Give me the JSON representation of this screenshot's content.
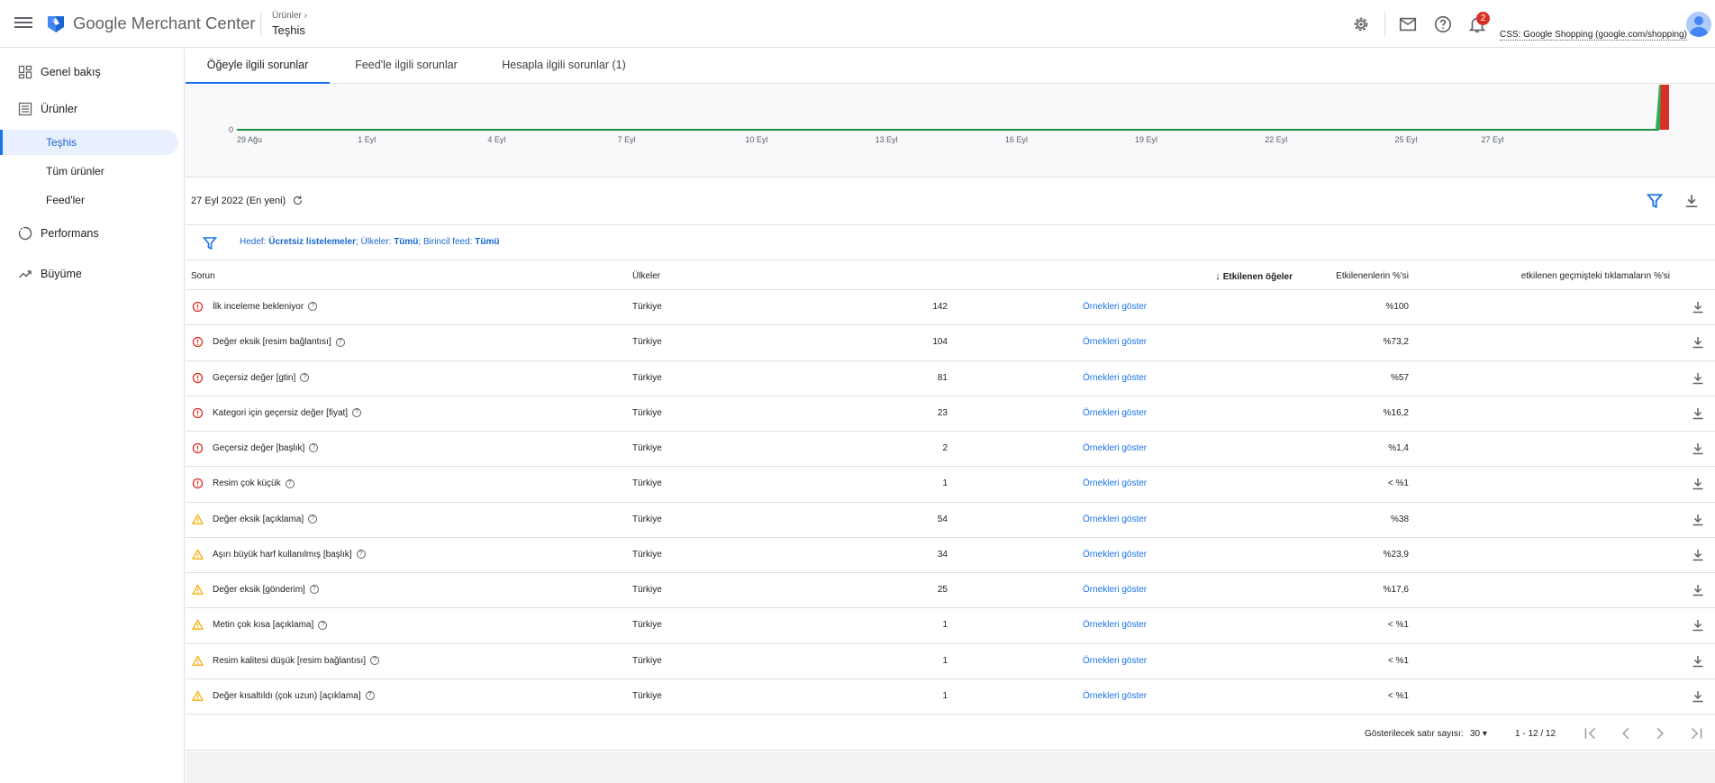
{
  "app": {
    "title_google": "Google",
    "title_rest": "Merchant Center"
  },
  "breadcrumb": {
    "parent": "Ürünler",
    "current": "Teşhis"
  },
  "header": {
    "notification_count": "2",
    "account_label": "CSS: Google Shopping (google.com/shopping)"
  },
  "sidebar": {
    "items": [
      {
        "label": "Genel bakış",
        "icon": "dashboard-icon"
      },
      {
        "label": "Ürünler",
        "icon": "list-icon"
      },
      {
        "label": "Teşhis",
        "sub": true,
        "active": true
      },
      {
        "label": "Tüm ürünler",
        "sub": true
      },
      {
        "label": "Feed'ler",
        "sub": true
      },
      {
        "label": "Performans",
        "icon": "performance-icon"
      },
      {
        "label": "Büyüme",
        "icon": "trending-up-icon"
      }
    ]
  },
  "tabs": [
    {
      "label": "Öğeyle ilgili sorunlar",
      "active": true
    },
    {
      "label": "Feed'le ilgili sorunlar"
    },
    {
      "label": "Hesapla ilgili sorunlar (1)"
    }
  ],
  "chart_data": {
    "type": "area",
    "y_tick": "0",
    "x_ticks": [
      "29 Ağu",
      "1 Eyl",
      "4 Eyl",
      "7 Eyl",
      "10 Eyl",
      "13 Eyl",
      "16 Eyl",
      "19 Eyl",
      "22 Eyl",
      "25 Eyl",
      "27 Eyl"
    ],
    "colors": {
      "baseline": "#1e8e3e",
      "errors": "#d93025",
      "warnings": "#34a853"
    }
  },
  "date_bar": {
    "date_label": "27 Eyl 2022 (En yeni)"
  },
  "filter": {
    "target_label": "Hedef:",
    "target_value": "Ücretsiz listelemeler",
    "countries_label": "; Ülkeler:",
    "countries_value": "Tümü",
    "feed_label": "; Birincil feed:",
    "feed_value": "Tümü"
  },
  "table": {
    "headers": {
      "issue": "Sorun",
      "countries": "Ülkeler",
      "affected": "Etkilenen öğeler",
      "affected_pct": "Etkilenenlerin %'si",
      "clicks_pct": "etkilenen geçmişteki tıklamaların %'si"
    },
    "link_label": "Örnekleri göster",
    "rows": [
      {
        "severity": "error",
        "issue": "İlk inceleme bekleniyor",
        "country": "Türkiye",
        "count": "142",
        "pct": "%100"
      },
      {
        "severity": "error",
        "issue": "Değer eksik [resim bağlantısı]",
        "country": "Türkiye",
        "count": "104",
        "pct": "%73,2"
      },
      {
        "severity": "error",
        "issue": "Geçersiz değer [gtin]",
        "country": "Türkiye",
        "count": "81",
        "pct": "%57"
      },
      {
        "severity": "error",
        "issue": "Kategori için geçersiz değer [fiyat]",
        "country": "Türkiye",
        "count": "23",
        "pct": "%16,2"
      },
      {
        "severity": "error",
        "issue": "Geçersiz değer [başlık]",
        "country": "Türkiye",
        "count": "2",
        "pct": "%1,4"
      },
      {
        "severity": "error",
        "issue": "Resim çok küçük",
        "country": "Türkiye",
        "count": "1",
        "pct": "< %1"
      },
      {
        "severity": "warning",
        "issue": "Değer eksik [açıklama]",
        "country": "Türkiye",
        "count": "54",
        "pct": "%38"
      },
      {
        "severity": "warning",
        "issue": "Aşırı büyük harf kullanılmış [başlık]",
        "country": "Türkiye",
        "count": "34",
        "pct": "%23,9"
      },
      {
        "severity": "warning",
        "issue": "Değer eksik [gönderim]",
        "country": "Türkiye",
        "count": "25",
        "pct": "%17,6"
      },
      {
        "severity": "warning",
        "issue": "Metin çok kısa [açıklama]",
        "country": "Türkiye",
        "count": "1",
        "pct": "< %1"
      },
      {
        "severity": "warning",
        "issue": "Resim kalitesi düşük [resim bağlantısı]",
        "country": "Türkiye",
        "count": "1",
        "pct": "< %1"
      },
      {
        "severity": "warning",
        "issue": "Değer kısaltıldı (çok uzun) [açıklama]",
        "country": "Türkiye",
        "count": "1",
        "pct": "< %1"
      }
    ]
  },
  "pager": {
    "rows_label": "Gösterilecek satır sayısı:",
    "rows_value": "30",
    "range": "1 - 12 / 12"
  }
}
